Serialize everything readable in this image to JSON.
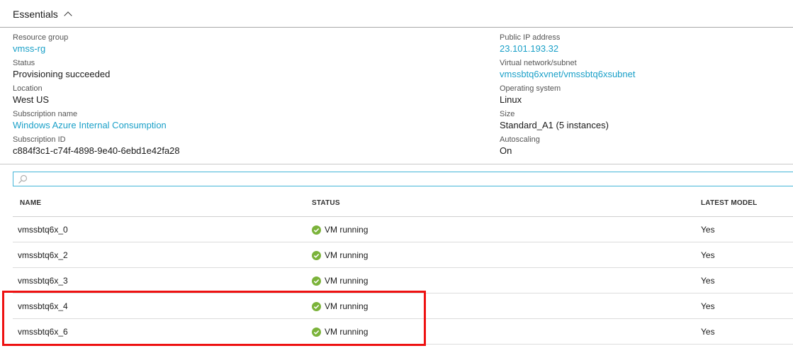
{
  "essentials": {
    "title": "Essentials",
    "left": [
      {
        "label": "Resource group",
        "value": "vmss-rg",
        "link": true
      },
      {
        "label": "Status",
        "value": "Provisioning succeeded",
        "link": false
      },
      {
        "label": "Location",
        "value": "West US",
        "link": false
      },
      {
        "label": "Subscription name",
        "value": "Windows Azure Internal Consumption",
        "link": true
      },
      {
        "label": "Subscription ID",
        "value": "c884f3c1-c74f-4898-9e40-6ebd1e42fa28",
        "link": false
      }
    ],
    "right": [
      {
        "label": "Public IP address",
        "value": "23.101.193.32",
        "link": true
      },
      {
        "label": "Virtual network/subnet",
        "value": "vmssbtq6xvnet/vmssbtq6xsubnet",
        "link": true
      },
      {
        "label": "Operating system",
        "value": "Linux",
        "link": false
      },
      {
        "label": "Size",
        "value": "Standard_A1 (5 instances)",
        "link": false
      },
      {
        "label": "Autoscaling",
        "value": "On",
        "link": false
      }
    ]
  },
  "search": {
    "placeholder": "",
    "value": ""
  },
  "table": {
    "columns": [
      "NAME",
      "STATUS",
      "LATEST MODEL"
    ],
    "rows": [
      {
        "name": "vmssbtq6x_0",
        "status": "VM running",
        "latest_model": "Yes"
      },
      {
        "name": "vmssbtq6x_2",
        "status": "VM running",
        "latest_model": "Yes"
      },
      {
        "name": "vmssbtq6x_3",
        "status": "VM running",
        "latest_model": "Yes"
      },
      {
        "name": "vmssbtq6x_4",
        "status": "VM running",
        "latest_model": "Yes"
      },
      {
        "name": "vmssbtq6x_6",
        "status": "VM running",
        "latest_model": "Yes"
      }
    ]
  },
  "colors": {
    "link": "#1aa0c8",
    "status_ok": "#7bb33a",
    "highlight": "#ee1111",
    "search_border": "#45b6d8"
  },
  "icons": {
    "collapse": "chevron-up-icon",
    "search": "search-icon",
    "status": "check-circle-icon"
  }
}
